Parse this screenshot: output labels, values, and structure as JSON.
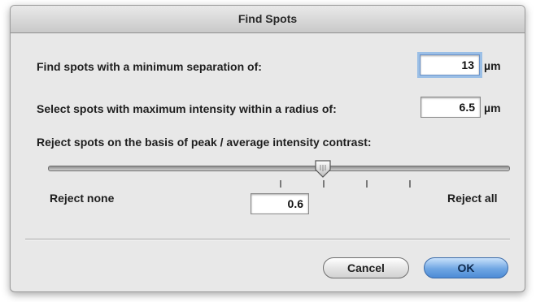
{
  "window": {
    "title": "Find Spots"
  },
  "separation": {
    "label": "Find spots with a minimum separation of:",
    "value": "13",
    "unit": "µm"
  },
  "radius": {
    "label": "Select spots with maximum intensity within a radius of:",
    "value": "6.5",
    "unit": "µm"
  },
  "contrast": {
    "label": "Reject spots on the basis of peak / average intensity contrast:",
    "slider_fraction": 0.6,
    "min_label": "Reject none",
    "max_label": "Reject all",
    "value": "0.6"
  },
  "buttons": {
    "cancel": "Cancel",
    "ok": "OK"
  }
}
